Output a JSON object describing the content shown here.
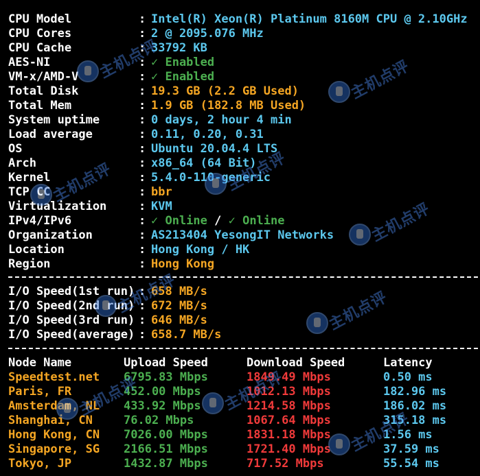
{
  "colors": {
    "background": "#000000",
    "key": "#ffffff",
    "cyan": "#5cc8ee",
    "orange": "#f5a623",
    "green": "#4caf50",
    "red": "#f03a3a",
    "watermark": "#4a86e8"
  },
  "system_info": [
    {
      "key": "CPU Model",
      "value": "Intel(R) Xeon(R) Platinum 8160M CPU @ 2.10GHz",
      "color": "#5cc8ee"
    },
    {
      "key": "CPU Cores",
      "value": "2 @ 2095.076 MHz",
      "color": "#5cc8ee"
    },
    {
      "key": "CPU Cache",
      "value": "33792 KB",
      "color": "#5cc8ee"
    },
    {
      "key": "AES-NI",
      "value": "✓ Enabled",
      "color": "#4caf50"
    },
    {
      "key": "VM-x/AMD-V",
      "value": "✓ Enabled",
      "color": "#4caf50"
    },
    {
      "key": "Total Disk",
      "value": "19.3 GB (2.2 GB Used)",
      "color": "#f5a623"
    },
    {
      "key": "Total Mem",
      "value": "1.9 GB (182.8 MB Used)",
      "color": "#f5a623"
    },
    {
      "key": "System uptime",
      "value": "0 days, 2 hour 4 min",
      "color": "#5cc8ee"
    },
    {
      "key": "Load average",
      "value": "0.11, 0.20, 0.31",
      "color": "#5cc8ee"
    },
    {
      "key": "OS",
      "value": "Ubuntu 20.04.4 LTS",
      "color": "#5cc8ee"
    },
    {
      "key": "Arch",
      "value": "x86_64 (64 Bit)",
      "color": "#5cc8ee"
    },
    {
      "key": "Kernel",
      "value": "5.4.0-110-generic",
      "color": "#5cc8ee"
    },
    {
      "key": "TCP CC",
      "value": "bbr",
      "color": "#f5a623"
    },
    {
      "key": "Virtualization",
      "value": "KVM",
      "color": "#5cc8ee"
    },
    {
      "key": "IPv4/IPv6",
      "value": "✓ Online / ✓ Online",
      "color": "#4caf50"
    },
    {
      "key": "Organization",
      "value": "AS213404 YesongIT Networks",
      "color": "#5cc8ee"
    },
    {
      "key": "Location",
      "value": "Hong Kong / HK",
      "color": "#5cc8ee"
    },
    {
      "key": "Region",
      "value": "Hong Kong",
      "color": "#f5a623"
    }
  ],
  "io_speed": [
    {
      "key": "I/O Speed(1st run)",
      "value": "658 MB/s"
    },
    {
      "key": "I/O Speed(2nd run)",
      "value": "672 MB/s"
    },
    {
      "key": "I/O Speed(3rd run)",
      "value": "646 MB/s"
    },
    {
      "key": "I/O Speed(average)",
      "value": "658.7 MB/s"
    }
  ],
  "speedtest": {
    "headers": [
      "Node Name",
      "Upload Speed",
      "Download Speed",
      "Latency"
    ],
    "rows": [
      {
        "node": "Speedtest.net",
        "upload": "6795.83 Mbps",
        "download": "1849.49 Mbps",
        "latency": "0.50 ms"
      },
      {
        "node": "Paris, FR",
        "upload": "452.00 Mbps",
        "download": "1012.13 Mbps",
        "latency": "182.96 ms"
      },
      {
        "node": "Amsterdam, NL",
        "upload": "433.92 Mbps",
        "download": "1214.58 Mbps",
        "latency": "186.02 ms"
      },
      {
        "node": "Shanghai, CN",
        "upload": "76.02 Mbps",
        "download": "1067.64 Mbps",
        "latency": "315.18 ms"
      },
      {
        "node": "Hong Kong, CN",
        "upload": "7026.00 Mbps",
        "download": "1831.18 Mbps",
        "latency": "1.56 ms"
      },
      {
        "node": "Singapore, SG",
        "upload": "2166.51 Mbps",
        "download": "1721.40 Mbps",
        "latency": "37.59 ms"
      },
      {
        "node": "Tokyo, JP",
        "upload": "1432.87 Mbps",
        "download": "717.52 Mbps",
        "latency": "55.54 ms"
      }
    ]
  },
  "watermark": {
    "text": "主机点评",
    "icon": "owl-logo-icon"
  }
}
